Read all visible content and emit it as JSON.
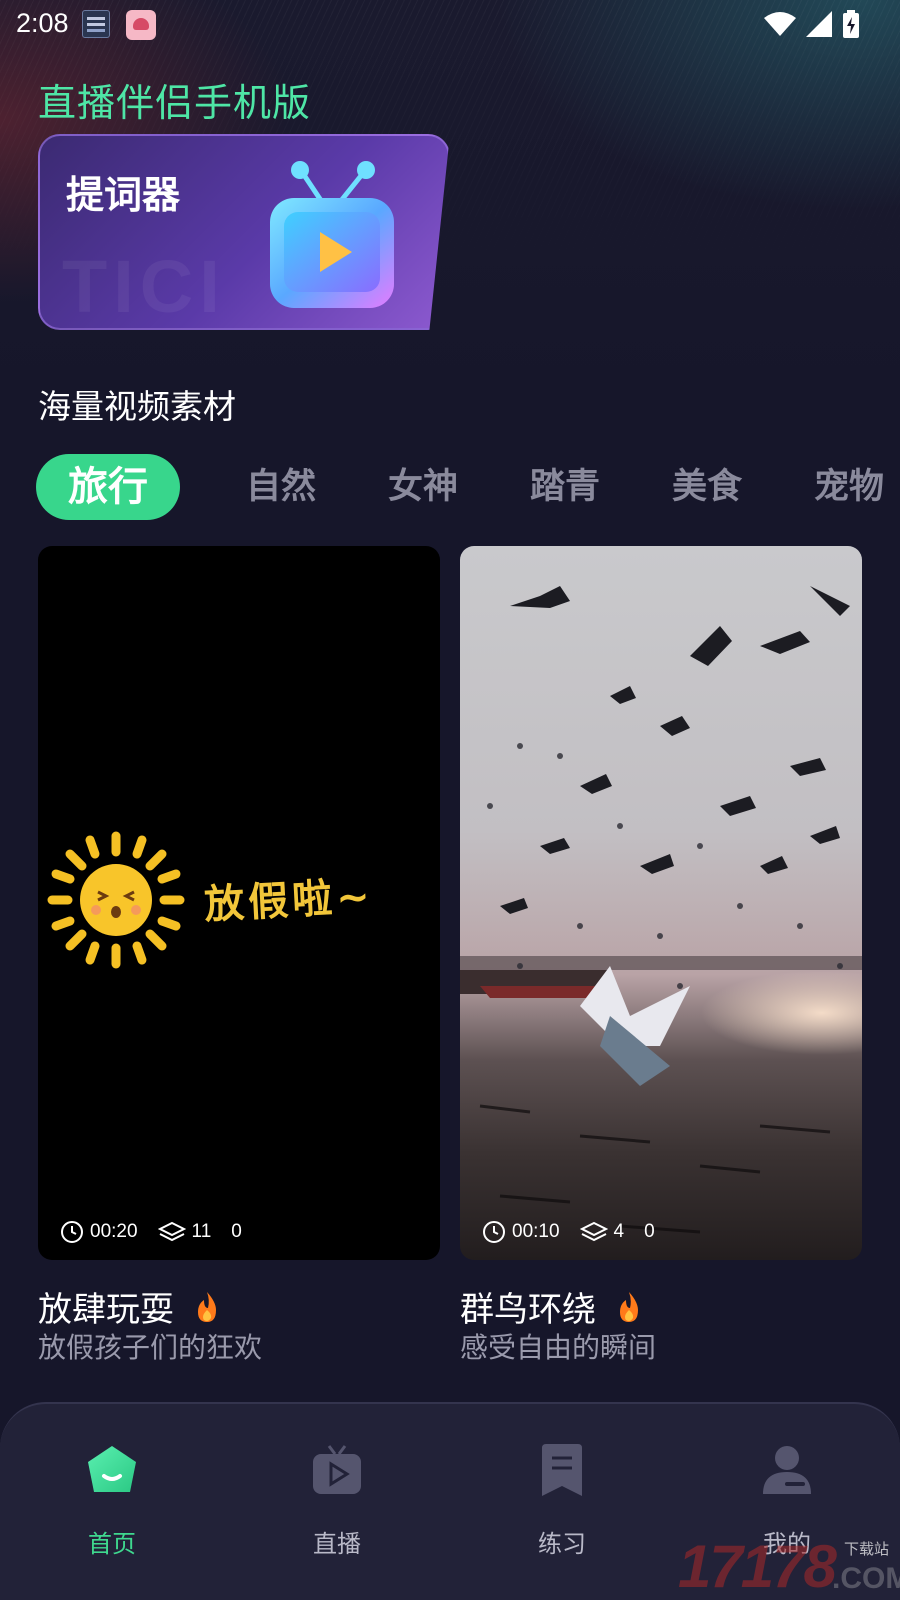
{
  "status_bar": {
    "time": "2:08"
  },
  "app_title": "直播伴侣手机版",
  "teleprompter": {
    "title": "提词器",
    "watermark": "TICI"
  },
  "section_title": "海量视频素材",
  "tabs": [
    {
      "label": "旅行",
      "active": true
    },
    {
      "label": "自然",
      "active": false
    },
    {
      "label": "女神",
      "active": false
    },
    {
      "label": "踏青",
      "active": false
    },
    {
      "label": "美食",
      "active": false
    },
    {
      "label": "宠物",
      "active": false
    }
  ],
  "videos": [
    {
      "overlay_text": "放假啦~",
      "duration": "00:20",
      "layers": "11",
      "count": "0",
      "title": "放肆玩耍",
      "subtitle": "放假孩子们的狂欢"
    },
    {
      "duration": "00:10",
      "layers": "4",
      "count": "0",
      "title": "群鸟环绕",
      "subtitle": "感受自由的瞬间"
    }
  ],
  "bottom_nav": [
    {
      "label": "首页",
      "icon": "home-icon",
      "active": true
    },
    {
      "label": "直播",
      "icon": "live-icon",
      "active": false
    },
    {
      "label": "练习",
      "icon": "practice-icon",
      "active": false
    },
    {
      "label": "我的",
      "icon": "profile-icon",
      "active": false
    }
  ],
  "watermark": {
    "number": "17178",
    "sub": "下载站",
    "domain": ".COM"
  },
  "colors": {
    "accent": "#38d68c",
    "title_green": "#4ee6a6",
    "background": "#16162a"
  }
}
